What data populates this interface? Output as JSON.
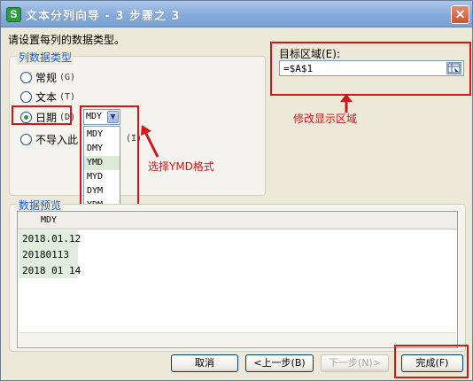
{
  "window": {
    "title": "文本分列向导 - 3 步骤之 3",
    "app_icon_letter": "S",
    "close_glyph": "✕"
  },
  "instruction": "请设置每列的数据类型。",
  "column_type": {
    "title": "列数据类型",
    "options": [
      {
        "label": "常规",
        "shortcut": "(G)",
        "checked": false
      },
      {
        "label": "文本",
        "shortcut": "(T)",
        "checked": false
      },
      {
        "label": "日期",
        "shortcut": "(D)",
        "checked": true
      },
      {
        "label": "不导入此",
        "shortcut": "(I)",
        "checked": false
      }
    ]
  },
  "date_combo": {
    "value": "MDY",
    "dropdown_glyph": "▼",
    "options": [
      "MDY",
      "DMY",
      "YMD",
      "MYD",
      "DYM",
      "YDM"
    ],
    "highlighted": "YMD"
  },
  "target": {
    "label": "目标区域(E):",
    "value": "=$A$1"
  },
  "annotations": {
    "select_ymd": "选择YMD格式",
    "modify_area": "修改显示区域"
  },
  "preview": {
    "title": "数据预览",
    "column_header": "MDY",
    "rows": [
      "2018.01.12",
      "20180113",
      "2018 01 14"
    ]
  },
  "buttons": {
    "cancel": "取消",
    "back": "<上一步(B)",
    "next": "下一步(N)>",
    "finish": "完成(F)"
  },
  "colors": {
    "annotation_red": "#d6151b",
    "group_title_blue": "#1c5fcf",
    "highlight_green": "#dcebd8"
  }
}
